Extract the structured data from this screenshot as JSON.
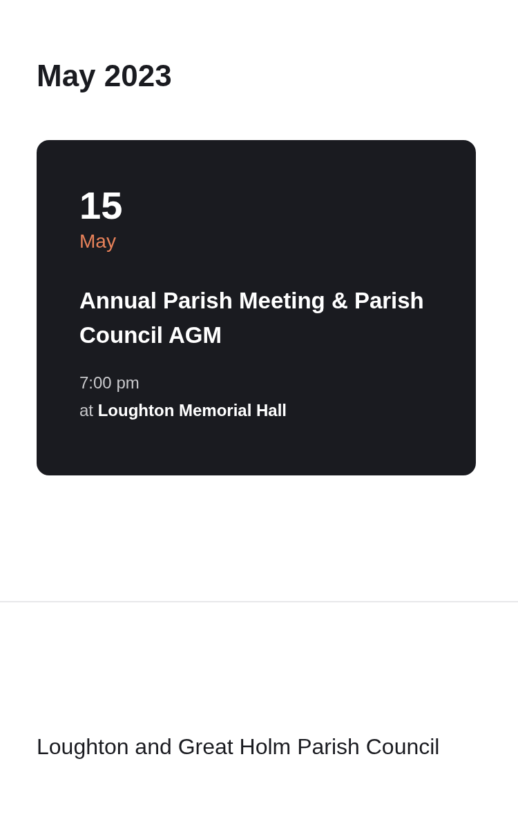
{
  "heading": "May 2023",
  "events": [
    {
      "day": "15",
      "month": "May",
      "title": "Annual Parish Meeting & Parish Council AGM",
      "time": "7:00 pm",
      "location": "at **Loughton Memorial Hall**"
    }
  ],
  "footer": {
    "title": "Loughton and Great Holm Parish Council"
  }
}
